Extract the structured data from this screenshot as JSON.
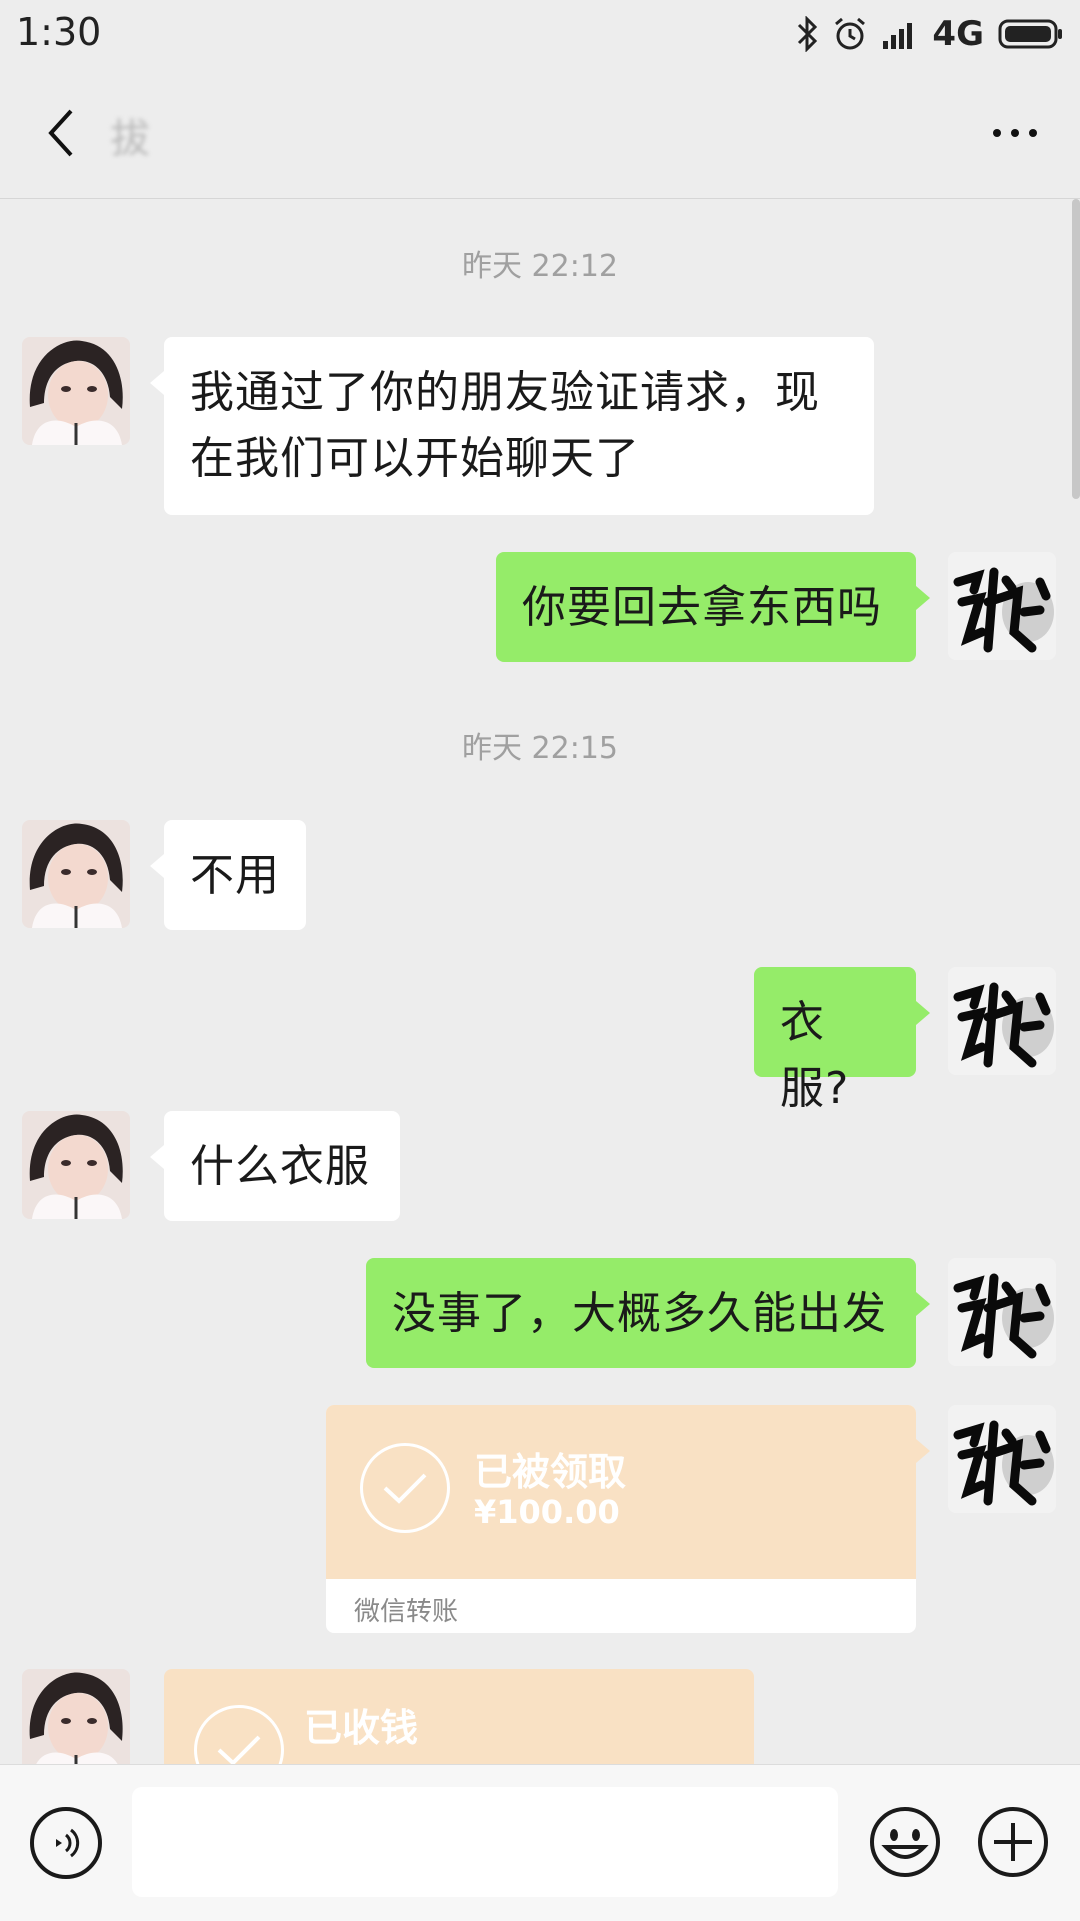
{
  "status_bar": {
    "time": "1:30",
    "network": "4G",
    "icons": [
      "bluetooth-icon",
      "alarm-icon",
      "signal-icon",
      "battery-icon"
    ]
  },
  "nav": {
    "title": "拔",
    "back_icon": "chevron-left-icon",
    "more_icon": "more-dots-icon"
  },
  "messages": {
    "ts1": "昨天 22:12",
    "m1": "我通过了你的朋友验证请求，现在我们可以开始聊天了",
    "m2": "你要回去拿东西吗",
    "ts2": "昨天 22:15",
    "m3": "不用",
    "m4": "衣服?",
    "m5": "什么衣服",
    "m6": "没事了，大概多久能出发"
  },
  "transfer_sent": {
    "status": "已被领取",
    "amount": "¥100.00",
    "label": "微信转账"
  },
  "transfer_received": {
    "status": "已收钱"
  },
  "input_bar": {
    "placeholder": "",
    "voice_icon": "voice-icon",
    "emoji_icon": "emoji-icon",
    "plus_icon": "plus-icon"
  },
  "colors": {
    "outgoing_bubble": "#95ec69",
    "incoming_bubble": "#ffffff",
    "transfer": "#f9e1c4",
    "background": "#ededed"
  }
}
